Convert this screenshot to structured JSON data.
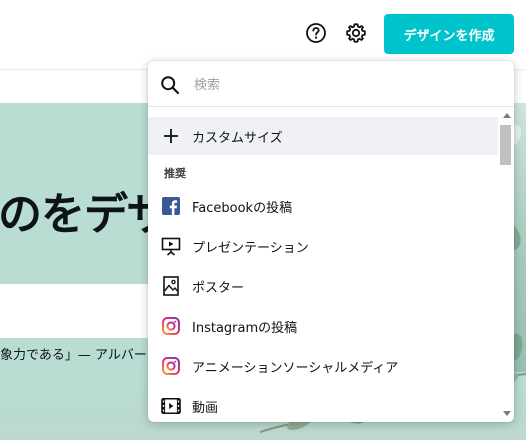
{
  "header": {
    "help_icon": "question-circle-icon",
    "settings_icon": "gear-icon",
    "create_button_label": "デザインを作成",
    "accent_color": "#00c4cc"
  },
  "hero": {
    "title_fragment": "のをデザ",
    "quote_fragment": "象力である」— アルバー"
  },
  "dropdown": {
    "search_placeholder": "検索",
    "custom_size_label": "カスタムサイズ",
    "section_label": "推奨",
    "items": [
      {
        "label": "Facebookの投稿",
        "icon": "facebook-icon"
      },
      {
        "label": "プレゼンテーション",
        "icon": "presentation-icon"
      },
      {
        "label": "ポスター",
        "icon": "poster-icon"
      },
      {
        "label": "Instagramの投稿",
        "icon": "instagram-icon"
      },
      {
        "label": "アニメーションソーシャルメディア",
        "icon": "instagram-icon"
      },
      {
        "label": "動画",
        "icon": "video-icon"
      }
    ]
  }
}
